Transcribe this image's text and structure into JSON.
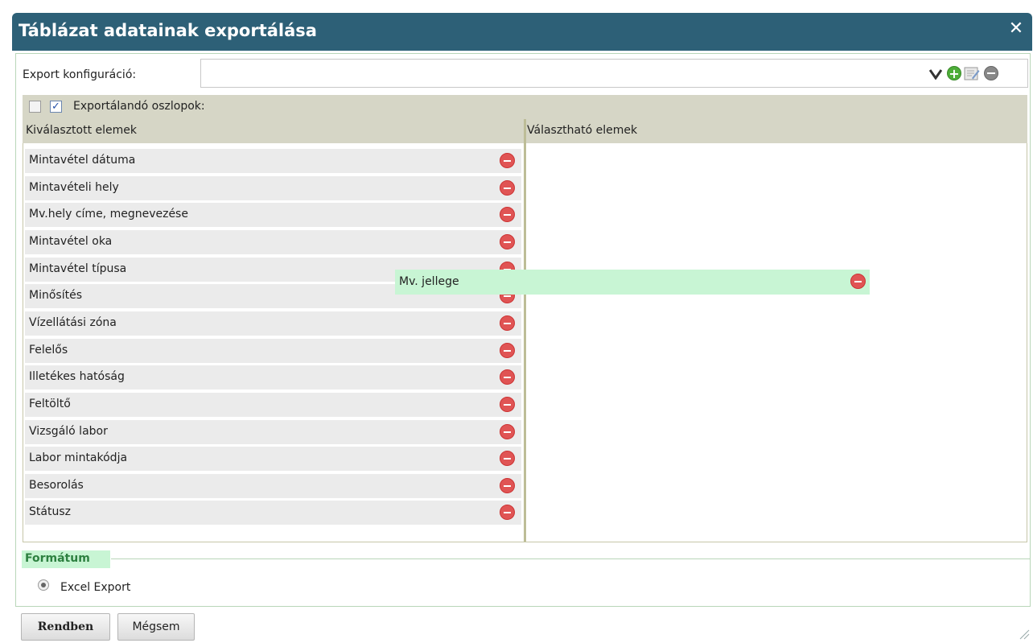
{
  "dialog": {
    "title": "Táblázat adatainak exportálása",
    "close_icon": "close-icon"
  },
  "config": {
    "label": "Export konfiguráció:",
    "value": "",
    "icons": [
      "chevron-down-icon",
      "add-icon",
      "edit-icon",
      "remove-icon"
    ]
  },
  "columns_panel": {
    "header_label": "Exportálandó oszlopok:",
    "selected_header": "Kiválasztott elemek",
    "available_header": "Választható elemek",
    "selected_items": [
      "Mintavétel dátuma",
      "Mintavételi hely",
      "Mv.hely címe, megnevezése",
      "Mintavétel oka",
      "Mintavétel típusa",
      "Minősítés",
      "Vízellátási zóna",
      "Felelős",
      "Illetékes hatóság",
      "Feltöltő",
      "Vizsgáló labor",
      "Labor mintakódja",
      "Besorolás",
      "Státusz"
    ],
    "dragging_item": "Mv. jellege"
  },
  "format": {
    "legend": "Formátum",
    "option": "Excel Export"
  },
  "buttons": {
    "ok": "Rendben",
    "cancel": "Mégsem"
  },
  "colors": {
    "titlebar": "#2d6077",
    "remove": "#e05454",
    "drag_bg": "#c8f5d4",
    "legend_text": "#2d8040"
  }
}
